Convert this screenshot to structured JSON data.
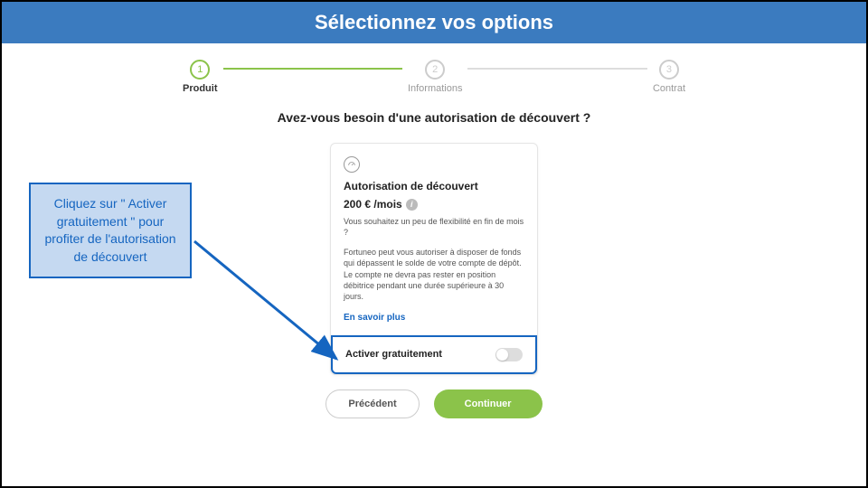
{
  "header": {
    "title": "Sélectionnez vos options"
  },
  "stepper": {
    "steps": [
      {
        "num": "1",
        "label": "Produit"
      },
      {
        "num": "2",
        "label": "Informations"
      },
      {
        "num": "3",
        "label": "Contrat"
      }
    ]
  },
  "question": "Avez-vous besoin d'une autorisation de découvert ?",
  "card": {
    "title": "Autorisation de découvert",
    "price": "200 € /mois",
    "sub": "Vous souhaitez un peu de flexibilité en fin de mois ?",
    "desc": "Fortuneo peut vous autoriser à disposer de fonds qui dépassent le solde de votre compte de dépôt. Le compte ne devra pas rester en position débitrice pendant une durée supérieure à 30 jours.",
    "link": "En savoir plus",
    "toggle_label": "Activer gratuitement"
  },
  "buttons": {
    "prev": "Précédent",
    "next": "Continuer"
  },
  "callout": {
    "text": "Cliquez sur \" Activer gratuitement \" pour profiter de l'autorisation de découvert"
  }
}
